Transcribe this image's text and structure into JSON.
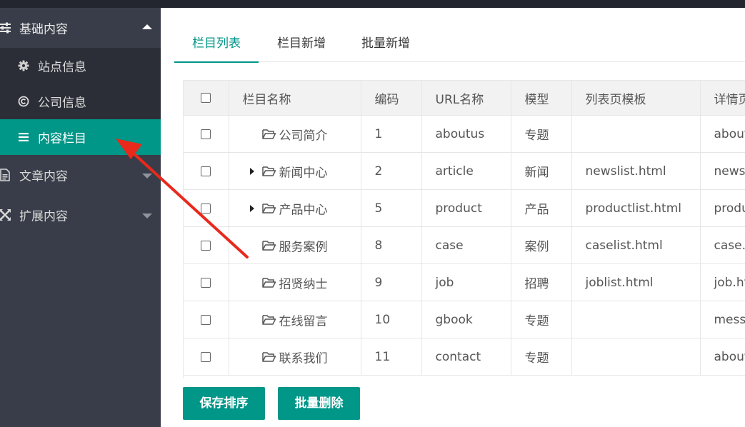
{
  "sidebar": {
    "group_basic": "基础内容",
    "sub_items": [
      "站点信息",
      "公司信息",
      "内容栏目"
    ],
    "group_article": "文章内容",
    "group_extend": "扩展内容"
  },
  "tabs": [
    "栏目列表",
    "栏目新增",
    "批量新增"
  ],
  "table": {
    "headers": [
      "栏目名称",
      "编码",
      "URL名称",
      "模型",
      "列表页模板",
      "详情页"
    ],
    "rows": [
      {
        "name": "公司简介",
        "code": "1",
        "url": "aboutus",
        "model": "专题",
        "list_tpl": "",
        "detail_tpl": "about"
      },
      {
        "name": "新闻中心",
        "code": "2",
        "url": "article",
        "model": "新闻",
        "list_tpl": "newslist.html",
        "detail_tpl": "news."
      },
      {
        "name": "产品中心",
        "code": "5",
        "url": "product",
        "model": "产品",
        "list_tpl": "productlist.html",
        "detail_tpl": "produ"
      },
      {
        "name": "服务案例",
        "code": "8",
        "url": "case",
        "model": "案例",
        "list_tpl": "caselist.html",
        "detail_tpl": "case.l"
      },
      {
        "name": "招贤纳士",
        "code": "9",
        "url": "job",
        "model": "招聘",
        "list_tpl": "joblist.html",
        "detail_tpl": "job.ht"
      },
      {
        "name": "在线留言",
        "code": "10",
        "url": "gbook",
        "model": "专题",
        "list_tpl": "",
        "detail_tpl": "messa"
      },
      {
        "name": "联系我们",
        "code": "11",
        "url": "contact",
        "model": "专题",
        "list_tpl": "",
        "detail_tpl": "about"
      }
    ]
  },
  "buttons": {
    "save_sort": "保存排序",
    "batch_delete": "批量删除"
  },
  "colors": {
    "accent": "#009688",
    "sidebar_bg": "#393d49",
    "subnav_bg": "#2b2e37",
    "arrow": "#e8291c"
  }
}
